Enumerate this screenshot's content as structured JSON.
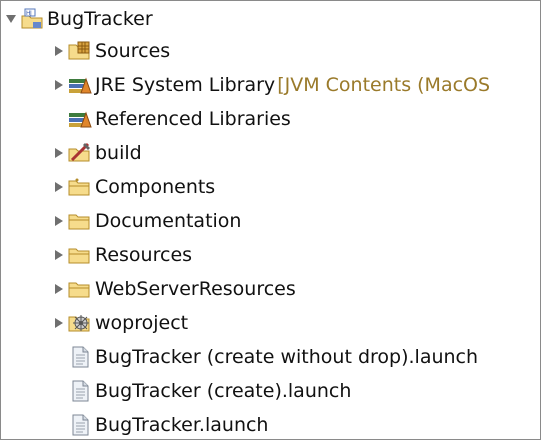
{
  "tree": {
    "project": {
      "label": "BugTracker",
      "icon": "wo-project-icon",
      "expanded": true
    },
    "items": [
      {
        "label": "Sources",
        "icon": "source-folder-icon",
        "expandable": true
      },
      {
        "label": "JRE System Library",
        "decoration": "[JVM Contents (MacOS",
        "icon": "library-icon",
        "expandable": true
      },
      {
        "label": "Referenced Libraries",
        "icon": "library-icon",
        "expandable": false
      },
      {
        "label": "build",
        "icon": "build-folder-icon",
        "expandable": true
      },
      {
        "label": "Components",
        "icon": "folder-icon",
        "expandable": true
      },
      {
        "label": "Documentation",
        "icon": "folder-icon",
        "expandable": true
      },
      {
        "label": "Resources",
        "icon": "folder-icon",
        "expandable": true
      },
      {
        "label": "WebServerResources",
        "icon": "folder-icon",
        "expandable": true
      },
      {
        "label": "woproject",
        "icon": "woproject-folder-icon",
        "expandable": true
      },
      {
        "label": "BugTracker (create without drop).launch",
        "icon": "file-icon",
        "expandable": false
      },
      {
        "label": "BugTracker (create).launch",
        "icon": "file-icon",
        "expandable": false
      },
      {
        "label": "BugTracker.launch",
        "icon": "file-icon",
        "expandable": false
      }
    ]
  },
  "colors": {
    "twisty": "#6f6f6f",
    "folder_fill": "#f6dc8c",
    "folder_stroke": "#b58d2a",
    "decoration_text": "#9a7a2a"
  }
}
